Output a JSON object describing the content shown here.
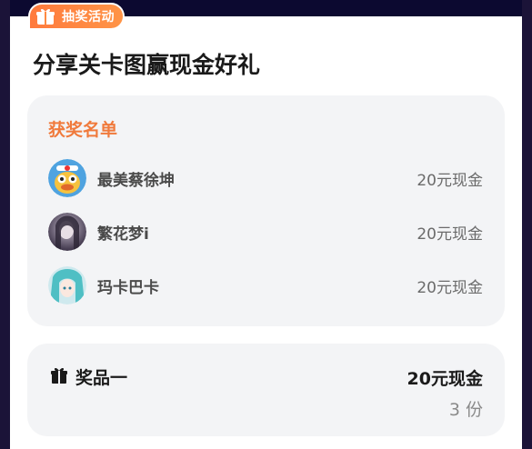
{
  "badge": {
    "label": "抽奖活动",
    "icon": "gift-icon"
  },
  "page": {
    "title": "分享关卡图赢现金好礼"
  },
  "winners": {
    "title": "获奖名单",
    "items": [
      {
        "name": "最美蔡徐坤",
        "prize": "20元现金",
        "avatar": "duck-avatar"
      },
      {
        "name": "繁花梦i",
        "prize": "20元现金",
        "avatar": "portrait-avatar"
      },
      {
        "name": "玛卡巴卡",
        "prize": "20元现金",
        "avatar": "anime-avatar"
      }
    ]
  },
  "prize": {
    "label": "奖品一",
    "value": "20元现金",
    "count": "3 份",
    "icon": "gift-icon"
  },
  "colors": {
    "accent": "#f07a3c",
    "badge": "#ff8a42",
    "panel": "#f3f4f6",
    "frame": "#1b1338"
  }
}
